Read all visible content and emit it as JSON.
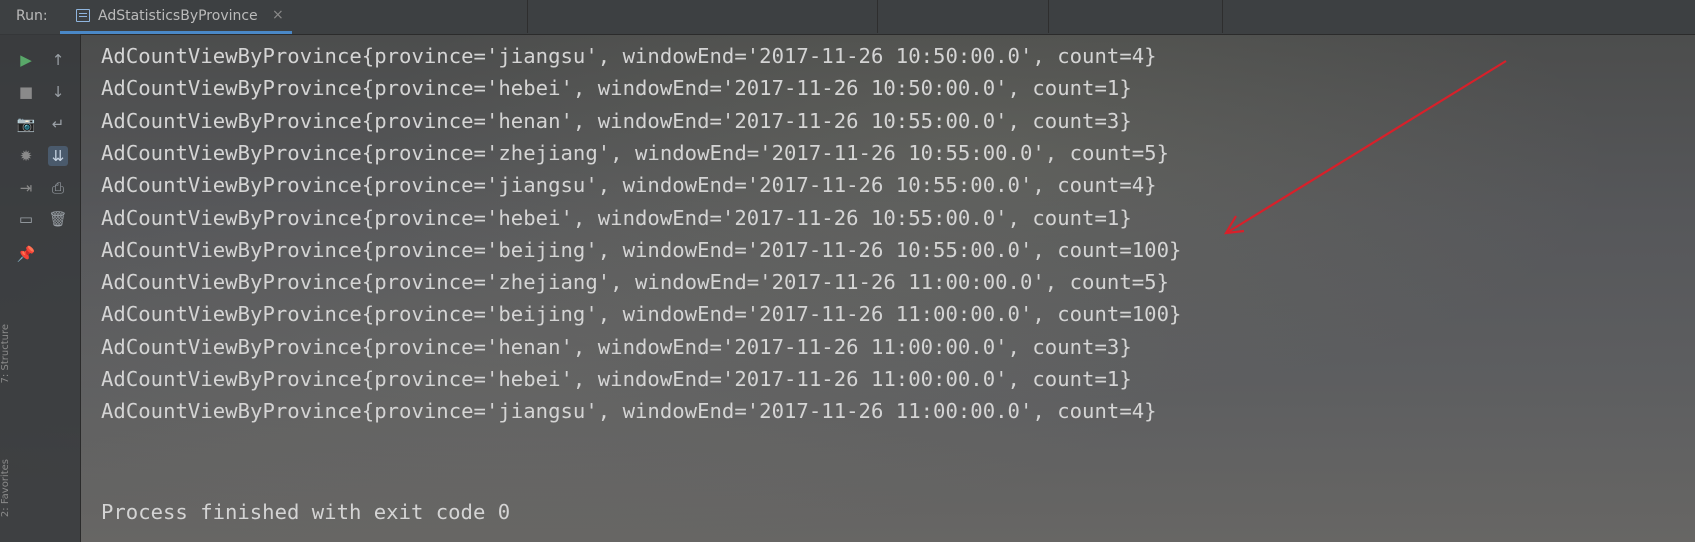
{
  "toolbar": {
    "run_label": "Run:",
    "tab_label": "AdStatisticsByProvince",
    "tab_close": "×"
  },
  "sidebar": {
    "vertical_labels": [
      "7: Structure",
      "2: Favorites"
    ],
    "tools": [
      {
        "name": "run-icon",
        "glyph": "▶",
        "color": "#59a869"
      },
      {
        "name": "stop-icon",
        "glyph": "■",
        "color": "#8a8a8a"
      },
      {
        "name": "camera-icon",
        "glyph": "📷",
        "color": "#8a8a8a"
      },
      {
        "name": "debug-icon",
        "glyph": "✹",
        "color": "#8a8a8a"
      },
      {
        "name": "exit-icon",
        "glyph": "⇥",
        "color": "#8a8a8a"
      },
      {
        "name": "layout-icon",
        "glyph": "▭",
        "color": "#9aa0a6"
      },
      {
        "name": "pin-icon",
        "glyph": "📌",
        "color": "#9aa0a6"
      },
      {
        "name": "up-arrow-icon",
        "glyph": "↑",
        "color": "#9aa0a6"
      },
      {
        "name": "down-arrow-icon",
        "glyph": "↓",
        "color": "#9aa0a6"
      },
      {
        "name": "soft-wrap-icon",
        "glyph": "↵",
        "color": "#9aa0a6"
      },
      {
        "name": "scroll-to-end-icon",
        "glyph": "⇊",
        "color": "#c9d5e3"
      },
      {
        "name": "print-icon",
        "glyph": "⎙",
        "color": "#9aa0a6"
      },
      {
        "name": "trash-icon",
        "glyph": "🗑",
        "color": "#9aa0a6"
      }
    ]
  },
  "console": {
    "lines": [
      "AdCountViewByProvince{province='jiangsu', windowEnd='2017-11-26 10:50:00.0', count=4}",
      "AdCountViewByProvince{province='hebei', windowEnd='2017-11-26 10:50:00.0', count=1}",
      "AdCountViewByProvince{province='henan', windowEnd='2017-11-26 10:55:00.0', count=3}",
      "AdCountViewByProvince{province='zhejiang', windowEnd='2017-11-26 10:55:00.0', count=5}",
      "AdCountViewByProvince{province='jiangsu', windowEnd='2017-11-26 10:55:00.0', count=4}",
      "AdCountViewByProvince{province='hebei', windowEnd='2017-11-26 10:55:00.0', count=1}",
      "AdCountViewByProvince{province='beijing', windowEnd='2017-11-26 10:55:00.0', count=100}",
      "AdCountViewByProvince{province='zhejiang', windowEnd='2017-11-26 11:00:00.0', count=5}",
      "AdCountViewByProvince{province='beijing', windowEnd='2017-11-26 11:00:00.0', count=100}",
      "AdCountViewByProvince{province='henan', windowEnd='2017-11-26 11:00:00.0', count=3}",
      "AdCountViewByProvince{province='hebei', windowEnd='2017-11-26 11:00:00.0', count=1}",
      "AdCountViewByProvince{province='jiangsu', windowEnd='2017-11-26 11:00:00.0', count=4}"
    ],
    "finish_message": "Process finished with exit code 0"
  },
  "annotation": {
    "arrow_color": "#d8202a"
  }
}
